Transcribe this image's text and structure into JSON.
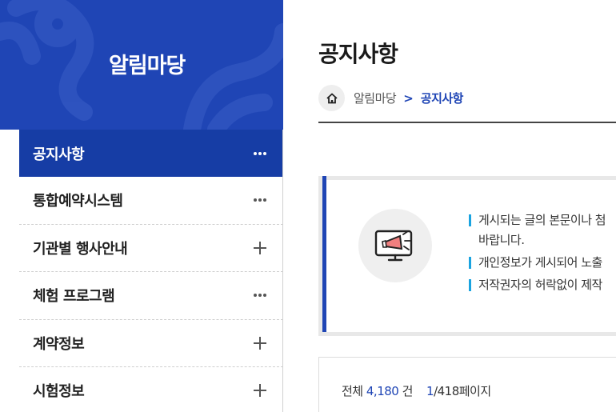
{
  "sidebar": {
    "title": "알림마당",
    "items": [
      {
        "label": "공지사항",
        "trail": "dots",
        "active": true
      },
      {
        "label": "통합예약시스템",
        "trail": "dots"
      },
      {
        "label": "기관별 행사안내",
        "trail": "plus"
      },
      {
        "label": "체험 프로그램",
        "trail": "dots"
      },
      {
        "label": "계약정보",
        "trail": "plus"
      },
      {
        "label": "시험정보",
        "trail": "plus"
      }
    ]
  },
  "main": {
    "title": "공지사항",
    "breadcrumb": {
      "parent": "알림마당",
      "separator": ">",
      "current": "공지사항"
    },
    "notice": {
      "line1": "게시되는 글의 본문이나 첨",
      "line1b": "바랍니다.",
      "line2": "개인정보가 게시되어 노출",
      "line3": "저작권자의 허락없이 제작"
    },
    "count": {
      "prefix": "전체",
      "total": "4,180",
      "unit": "건",
      "page_current": "1",
      "page_rest": "/418페이지"
    }
  },
  "colors": {
    "brand": "#1f45b5",
    "accent": "#1aa3e0",
    "active_menu": "#163da5"
  }
}
